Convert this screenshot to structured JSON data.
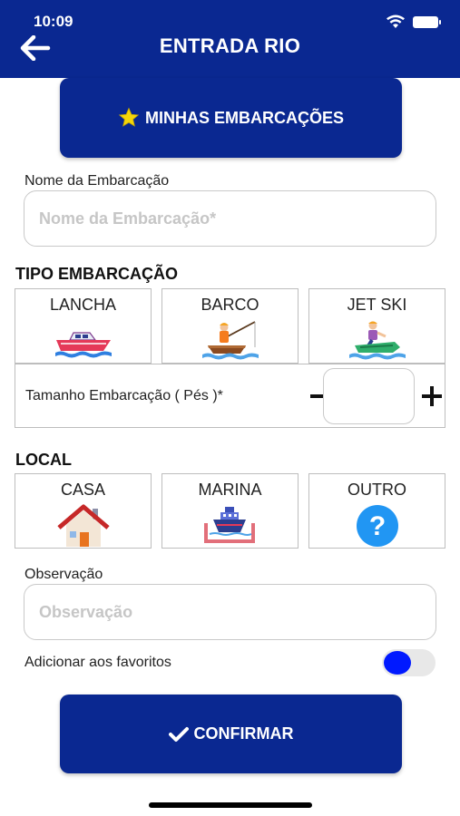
{
  "status_bar": {
    "time": "10:09",
    "icons": [
      "wifi-icon",
      "battery-icon"
    ]
  },
  "header": {
    "title": "ENTRADA RIO",
    "back_icon": "arrow-left-icon"
  },
  "favorites_button": {
    "label": "MINHAS EMBARCAÇÕES",
    "icon": "star-icon"
  },
  "boat_name": {
    "label": "Nome da Embarcação",
    "placeholder": "Nome da Embarcação*",
    "value": ""
  },
  "boat_type": {
    "title": "TIPO EMBARCAÇÃO",
    "options": [
      {
        "label": "LANCHA",
        "icon": "speedboat-icon"
      },
      {
        "label": "BARCO",
        "icon": "fishing-boat-icon"
      },
      {
        "label": "JET SKI",
        "icon": "jet-ski-icon"
      }
    ]
  },
  "boat_size": {
    "label": "Tamanho Embarcação ( Pés )*",
    "value": "",
    "decrement_icon": "minus-icon",
    "increment_icon": "plus-icon"
  },
  "location": {
    "title": "LOCAL",
    "options": [
      {
        "label": "CASA",
        "icon": "house-icon"
      },
      {
        "label": "MARINA",
        "icon": "marina-icon"
      },
      {
        "label": "OUTRO",
        "icon": "question-icon"
      }
    ]
  },
  "observation": {
    "label": "Observação",
    "placeholder": "Observação",
    "value": ""
  },
  "favorites_toggle": {
    "label": "Adicionar aos favoritos",
    "on": false
  },
  "confirm_button": {
    "label": "CONFIRMAR",
    "icon": "check-icon"
  },
  "colors": {
    "primary": "#0a2891",
    "toggle_knob": "#0019ff",
    "star": "#f5d60a",
    "help": "#2196f3"
  }
}
